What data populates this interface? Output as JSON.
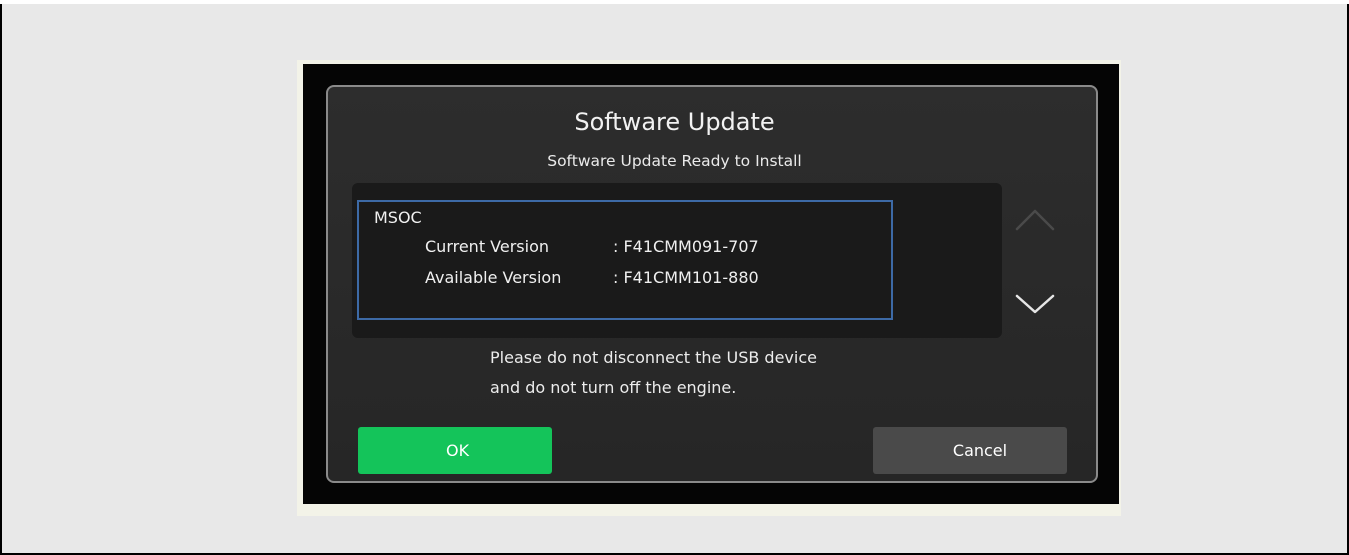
{
  "dialog": {
    "title": "Software Update",
    "subtitle": "Software Update Ready to Install",
    "module": "MSOC",
    "current_label": "Current Version",
    "current_value": ": F41CMM091-707",
    "available_label": "Available Version",
    "available_value": ": F41CMM101-880",
    "message_line1": "Please do not disconnect the USB device",
    "message_line2": "and do not turn off the engine.",
    "ok_label": "OK",
    "cancel_label": "Cancel"
  },
  "colors": {
    "ok_button": "#14c45a",
    "cancel_button": "#4a4a4a",
    "selection_border": "#3d6aa6",
    "dialog_background": "#2a2a2a"
  },
  "icons": {
    "scroll_up": "chevron-up-icon",
    "scroll_down": "chevron-down-icon"
  }
}
